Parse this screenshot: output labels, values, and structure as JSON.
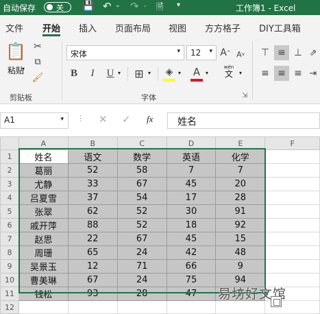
{
  "window": {
    "autosave_label": "自动保存",
    "autosave_state": "关",
    "title": "工作簿1 - Excel"
  },
  "menu": [
    "文件",
    "开始",
    "插入",
    "页面布局",
    "视图",
    "方方格子",
    "DIY工具箱"
  ],
  "ribbon": {
    "paste_label": "粘贴",
    "clipboard_group": "剪贴板",
    "font_name": "宋体",
    "font_size": "12",
    "font_group": "字体",
    "bold": "B",
    "italic": "I",
    "underline": "U",
    "font_color_icon": "A",
    "phonetic_label": "wén",
    "phonetic_char": "文",
    "grow_font": "A",
    "shrink_font": "A",
    "colors": {
      "accent": "#217346",
      "highlight": "#ffff00",
      "font_color": "#e81123"
    }
  },
  "formula_bar": {
    "name_box": "A1",
    "fx_label": "fx",
    "value": "姓名"
  },
  "sheet": {
    "columns": [
      "A",
      "B",
      "C",
      "D",
      "E",
      "F"
    ],
    "rows": [
      "1",
      "2",
      "3",
      "4",
      "5",
      "6",
      "7",
      "8",
      "9",
      "10",
      "11",
      "12"
    ],
    "cells": [
      [
        "姓名",
        "语文",
        "数学",
        "英语",
        "化学"
      ],
      [
        "葛丽",
        "52",
        "58",
        "7",
        "7"
      ],
      [
        "尤静",
        "33",
        "67",
        "45",
        "20"
      ],
      [
        "吕夏雪",
        "37",
        "54",
        "17",
        "28"
      ],
      [
        "张翠",
        "62",
        "52",
        "30",
        "91"
      ],
      [
        "戚开萍",
        "88",
        "52",
        "18",
        "92"
      ],
      [
        "赵思",
        "22",
        "67",
        "45",
        "15"
      ],
      [
        "周珊",
        "65",
        "24",
        "42",
        "48"
      ],
      [
        "吴景玉",
        "12",
        "71",
        "66",
        "9"
      ],
      [
        "曹美琳",
        "67",
        "24",
        "75",
        "94"
      ],
      [
        "钱松",
        "93",
        "28",
        "47",
        "7"
      ]
    ]
  },
  "watermark": "易坊好文馆"
}
